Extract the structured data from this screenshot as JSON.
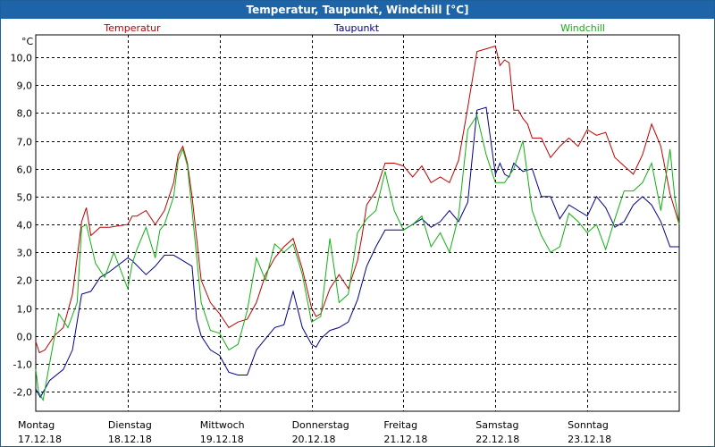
{
  "window": {
    "title": "Temperatur, Taupunkt, Windchill [°C]"
  },
  "chart_data": {
    "type": "line",
    "title": "Temperatur, Taupunkt, Windchill [°C]",
    "ylabel": "°C",
    "ylim": [
      -2.7,
      10.8
    ],
    "yticks": [
      -2,
      -1,
      0,
      1,
      2,
      3,
      4,
      5,
      6,
      7,
      8,
      9,
      10
    ],
    "ytick_labels": [
      "-2,0",
      "-1,0",
      "0,0",
      "1,0",
      "2,0",
      "3,0",
      "4,0",
      "5,0",
      "6,0",
      "7,0",
      "8,0",
      "9,0",
      "10,0"
    ],
    "xlim": [
      0,
      7
    ],
    "days": [
      {
        "name": "Montag",
        "date": "17.12.18"
      },
      {
        "name": "Dienstag",
        "date": "18.12.18"
      },
      {
        "name": "Mittwoch",
        "date": "19.12.18"
      },
      {
        "name": "Donnerstag",
        "date": "20.12.18"
      },
      {
        "name": "Freitag",
        "date": "21.12.18"
      },
      {
        "name": "Samstag",
        "date": "22.12.18"
      },
      {
        "name": "Sonntag",
        "date": "23.12.18"
      }
    ],
    "grid": true,
    "legend_position": "top",
    "series": [
      {
        "name": "Temperatur",
        "color": "#c00000",
        "x": [
          0,
          0.04,
          0.1,
          0.2,
          0.3,
          0.4,
          0.5,
          0.55,
          0.6,
          0.7,
          0.8,
          1.0,
          1.05,
          1.1,
          1.2,
          1.3,
          1.4,
          1.5,
          1.55,
          1.6,
          1.65,
          1.7,
          1.8,
          1.9,
          2.0,
          2.1,
          2.2,
          2.3,
          2.4,
          2.5,
          2.6,
          2.7,
          2.8,
          2.9,
          3.0,
          3.05,
          3.1,
          3.2,
          3.3,
          3.4,
          3.5,
          3.55,
          3.6,
          3.7,
          3.8,
          3.9,
          4.0,
          4.1,
          4.2,
          4.3,
          4.4,
          4.5,
          4.6,
          4.7,
          4.8,
          4.9,
          5.0,
          5.05,
          5.1,
          5.15,
          5.2,
          5.25,
          5.3,
          5.35,
          5.4,
          5.5,
          5.6,
          5.7,
          5.8,
          5.9,
          6.0,
          6.1,
          6.2,
          6.3,
          6.4,
          6.5,
          6.6,
          6.7,
          6.8,
          6.9,
          7.0
        ],
        "values": [
          -0.2,
          -0.6,
          -0.5,
          0.0,
          0.3,
          1.5,
          4.1,
          4.6,
          3.6,
          3.9,
          3.9,
          4.0,
          4.3,
          4.3,
          4.5,
          4.0,
          4.5,
          5.5,
          6.5,
          6.8,
          6.2,
          5.0,
          2.0,
          1.2,
          0.8,
          0.3,
          0.5,
          0.6,
          1.2,
          2.2,
          2.8,
          3.2,
          3.5,
          2.4,
          1.0,
          0.7,
          0.8,
          1.7,
          2.2,
          1.7,
          2.7,
          3.6,
          4.7,
          5.2,
          6.2,
          6.2,
          6.1,
          5.7,
          6.1,
          5.5,
          5.7,
          5.5,
          6.3,
          8.2,
          10.2,
          10.3,
          10.4,
          9.7,
          9.9,
          9.8,
          8.1,
          8.1,
          7.8,
          7.6,
          7.1,
          7.1,
          6.4,
          6.8,
          7.1,
          6.8,
          7.4,
          7.2,
          7.3,
          6.4,
          6.1,
          5.8,
          6.5,
          7.6,
          6.8,
          5.1,
          4.0
        ]
      },
      {
        "name": "Taupunkt",
        "color": "#00008b",
        "x": [
          0,
          0.05,
          0.15,
          0.3,
          0.4,
          0.5,
          0.6,
          0.7,
          0.8,
          1.0,
          1.05,
          1.2,
          1.3,
          1.4,
          1.5,
          1.6,
          1.7,
          1.75,
          1.8,
          1.9,
          2.0,
          2.1,
          2.2,
          2.3,
          2.4,
          2.5,
          2.6,
          2.7,
          2.8,
          2.9,
          3.0,
          3.05,
          3.1,
          3.2,
          3.3,
          3.4,
          3.5,
          3.6,
          3.7,
          3.8,
          4.0,
          4.1,
          4.2,
          4.3,
          4.4,
          4.5,
          4.6,
          4.7,
          4.8,
          4.9,
          5.0,
          5.05,
          5.1,
          5.15,
          5.2,
          5.3,
          5.4,
          5.5,
          5.6,
          5.7,
          5.8,
          5.9,
          6.0,
          6.1,
          6.2,
          6.3,
          6.4,
          6.5,
          6.6,
          6.7,
          6.8,
          6.9,
          7.0
        ],
        "values": [
          -1.9,
          -2.2,
          -1.6,
          -1.2,
          -0.5,
          1.5,
          1.6,
          2.1,
          2.3,
          2.8,
          2.7,
          2.2,
          2.5,
          2.9,
          2.9,
          2.7,
          2.5,
          0.6,
          0.0,
          -0.5,
          -0.7,
          -1.3,
          -1.4,
          -1.4,
          -0.5,
          -0.1,
          0.3,
          0.4,
          1.6,
          0.3,
          -0.3,
          -0.4,
          -0.1,
          0.2,
          0.3,
          0.5,
          1.3,
          2.5,
          3.2,
          3.8,
          3.8,
          4.0,
          4.2,
          3.9,
          4.1,
          4.5,
          4.1,
          4.8,
          8.1,
          8.2,
          5.8,
          6.2,
          5.8,
          5.7,
          6.2,
          5.9,
          6.0,
          5.0,
          5.0,
          4.2,
          4.7,
          4.5,
          4.3,
          5.0,
          4.6,
          3.9,
          4.1,
          4.7,
          5.0,
          4.7,
          4.1,
          3.2,
          3.2
        ]
      },
      {
        "name": "Windchill",
        "color": "#10b010",
        "x": [
          0,
          0.03,
          0.08,
          0.15,
          0.25,
          0.35,
          0.45,
          0.5,
          0.55,
          0.65,
          0.75,
          0.85,
          1.0,
          1.05,
          1.1,
          1.2,
          1.3,
          1.35,
          1.4,
          1.5,
          1.55,
          1.6,
          1.65,
          1.7,
          1.8,
          1.9,
          2.0,
          2.1,
          2.2,
          2.3,
          2.4,
          2.5,
          2.6,
          2.7,
          2.8,
          2.9,
          3.0,
          3.1,
          3.2,
          3.3,
          3.4,
          3.5,
          3.6,
          3.7,
          3.8,
          3.9,
          4.0,
          4.1,
          4.2,
          4.3,
          4.4,
          4.5,
          4.6,
          4.7,
          4.8,
          4.9,
          5.0,
          5.1,
          5.2,
          5.3,
          5.4,
          5.5,
          5.6,
          5.7,
          5.8,
          5.9,
          6.0,
          6.1,
          6.2,
          6.3,
          6.4,
          6.5,
          6.6,
          6.7,
          6.8,
          6.9,
          6.95,
          7.0
        ],
        "values": [
          -1.2,
          -2.0,
          -2.3,
          -1.0,
          0.8,
          0.3,
          1.2,
          3.9,
          4.0,
          2.6,
          2.1,
          3.0,
          1.7,
          2.6,
          3.1,
          3.9,
          2.8,
          3.8,
          4.0,
          5.0,
          6.3,
          6.7,
          6.1,
          4.5,
          1.2,
          0.2,
          0.1,
          -0.5,
          -0.3,
          0.9,
          2.8,
          2.0,
          3.3,
          3.0,
          3.3,
          2.2,
          0.5,
          0.7,
          3.5,
          1.2,
          1.5,
          3.7,
          4.2,
          4.5,
          5.9,
          4.5,
          3.8,
          4.0,
          4.3,
          3.2,
          3.7,
          3.0,
          4.3,
          7.4,
          7.9,
          6.5,
          5.5,
          5.5,
          6.0,
          7.0,
          4.5,
          3.6,
          3.0,
          3.2,
          4.4,
          4.1,
          3.7,
          4.0,
          3.1,
          4.2,
          5.2,
          5.2,
          5.5,
          6.2,
          4.5,
          6.7,
          5.0,
          4.0
        ]
      }
    ]
  }
}
